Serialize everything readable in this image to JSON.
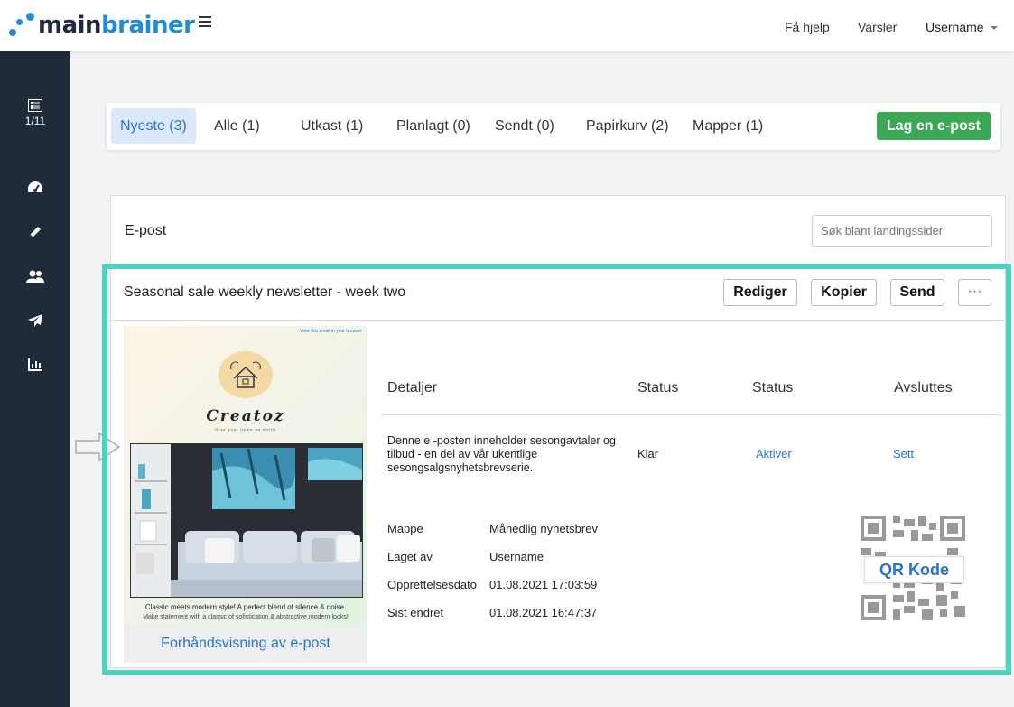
{
  "header": {
    "logo_main": "main",
    "logo_brain": "brainer",
    "help_label": "Få hjelp",
    "notifications_label": "Varsler",
    "username": "Username"
  },
  "sidebar": {
    "page_indicator": "1/11",
    "items": [
      {
        "icon": "list-icon"
      },
      {
        "icon": "dashboard-icon"
      },
      {
        "icon": "pencil-icon"
      },
      {
        "icon": "users-icon"
      },
      {
        "icon": "send-icon"
      },
      {
        "icon": "bar-chart-icon"
      }
    ]
  },
  "tabs": [
    {
      "label": "Nyeste (3)",
      "active": true
    },
    {
      "label": "Alle (1)"
    },
    {
      "label": "Utkast (1)"
    },
    {
      "label": "Planlagt (0)"
    },
    {
      "label": "Sendt (0)"
    },
    {
      "label": "Papirkurv (2)"
    },
    {
      "label": "Mapper (1)"
    }
  ],
  "create_button": "Lag en e-post",
  "panel": {
    "title": "E-post",
    "search_placeholder": "Søk blant landingssider"
  },
  "item": {
    "title": "Seasonal sale weekly newsletter - week two",
    "actions": {
      "edit": "Rediger",
      "copy": "Kopier",
      "send": "Send",
      "more": "···"
    },
    "preview": {
      "top_link": "View this email in your browser",
      "brand": "Creatoz",
      "tagline": "Give your home an outfit",
      "caption1": "Classic meets modern style! A perfect blend of silence & noise.",
      "caption2": "Make statement with a classic of sofistication & abstractive modern looks!",
      "link": "Forhåndsvisning av e-post"
    },
    "headers": {
      "details": "Detaljer",
      "status1": "Status",
      "status2": "Status",
      "ends": "Avsluttes"
    },
    "description": "Denne e -posten inneholder sesongavtaler og tilbud - en del av vår ukentlige sesongsalgsnyhetsbrevserie.",
    "status_value": "Klar",
    "activate_link": "Aktiver",
    "set_link": "Sett",
    "meta": [
      {
        "label": "Mappe",
        "value": "Månedlig nyhetsbrev"
      },
      {
        "label": "Laget av",
        "value": "Username"
      },
      {
        "label": "Opprettelsesdato",
        "value": "01.08.2021 17:03:59"
      },
      {
        "label": "Sist endret",
        "value": "01.08.2021 16:47:37"
      }
    ],
    "qr_label": "QR Kode"
  },
  "colors": {
    "accent": "#2a72c9",
    "sidebar": "#1f2b3b",
    "create_button": "#3aa855",
    "highlight": "#4dd2bd"
  }
}
